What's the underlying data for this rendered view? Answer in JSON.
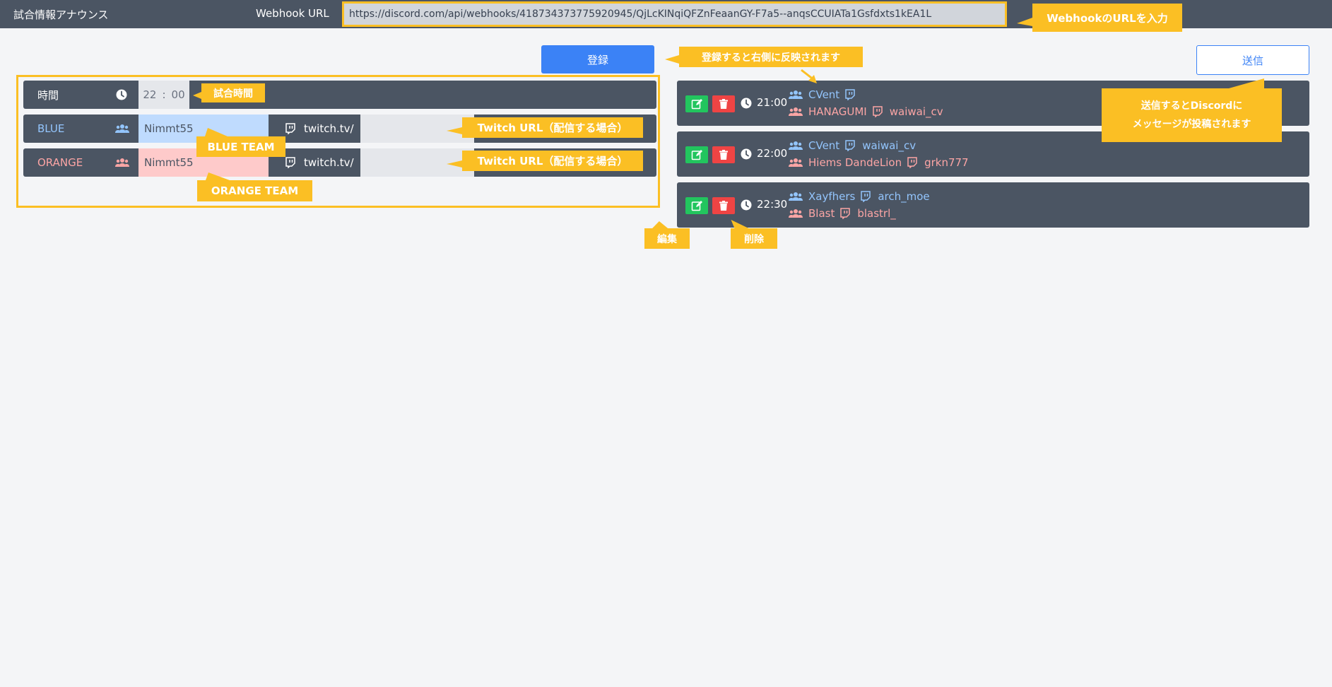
{
  "header": {
    "app_title": "試合情報アナウンス",
    "webhook_label": "Webhook URL",
    "webhook_value": "https://discord.com/api/webhooks/418734373775920945/QjLcKINqiQFZnFeaanGY-F7a5--anqsCCUIATa1Gsfdxts1kEA1L"
  },
  "buttons": {
    "register": "登録",
    "send": "送信"
  },
  "form": {
    "time_label": "時間",
    "hour": "22",
    "separator": ":",
    "minute": "00",
    "blue": {
      "label": "BLUE",
      "team": "Nimmt55",
      "twitch": "twitch.tv/"
    },
    "orange": {
      "label": "ORANGE",
      "team": "Nimmt55",
      "twitch": "twitch.tv/"
    }
  },
  "matches": [
    {
      "time": "21:00",
      "blue_team": "CVent",
      "blue_twitch": "",
      "orange_team": "HANAGUMI",
      "orange_twitch": "waiwai_cv"
    },
    {
      "time": "22:00",
      "blue_team": "CVent",
      "blue_twitch": "waiwai_cv",
      "orange_team": "Hiems DandeLion",
      "orange_twitch": "grkn777"
    },
    {
      "time": "22:30",
      "blue_team": "Xayfhers",
      "blue_twitch": "arch_moe",
      "orange_team": "Blast",
      "orange_twitch": "blastrl_"
    }
  ],
  "callouts": {
    "webhook": "WebhookのURLを入力",
    "register_hint": "登録すると右側に反映されます",
    "send_hint_1": "送信するとDiscordに",
    "send_hint_2": "メッセージが投稿されます",
    "match_time": "試合時間",
    "blue_team": "BLUE TEAM",
    "orange_team": "ORANGE TEAM",
    "twitch_url_blue": "Twitch URL（配信する場合）",
    "twitch_url_orange": "Twitch URL（配信する場合）",
    "edit": "編集",
    "delete": "削除"
  },
  "colors": {
    "bar": "#4b5563",
    "accent": "#3b82f6",
    "callout": "#fbbf24",
    "blue_text": "#93c5fd",
    "orange_text": "#fca5a5",
    "blue_field": "#bfdbfe",
    "orange_field": "#fecaca",
    "edit": "#22c55e",
    "delete": "#ef4444"
  },
  "icons": [
    "clock-icon",
    "users-icon",
    "twitch-icon",
    "edit-icon",
    "trash-icon"
  ]
}
